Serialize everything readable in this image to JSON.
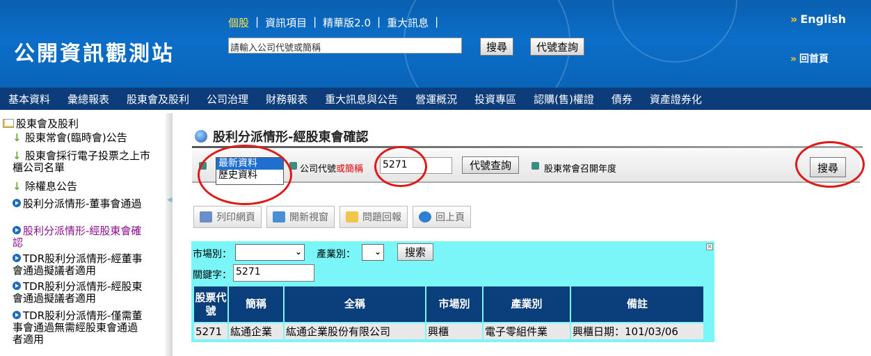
{
  "header": {
    "logo": "公開資訊觀測站",
    "topnav": [
      "個股",
      "資訊項目",
      "精華版2.0",
      "重大訊息"
    ],
    "search_placeholder": "請輸入公司代號或簡稱",
    "search_button": "搜尋",
    "code_lookup_button": "代號查詢",
    "english": "English",
    "home": "回首頁"
  },
  "mainnav": [
    "基本資料",
    "彙總報表",
    "股東會及股利",
    "公司治理",
    "財務報表",
    "重大訊息與公告",
    "營運概況",
    "投資專區",
    "認購(售)權證",
    "債券",
    "資產證券化"
  ],
  "sidebar": {
    "root": "股東會及股利",
    "items": [
      {
        "label": "股東常會(臨時會)公告",
        "icon": "download-icon"
      },
      {
        "label": "股東會採行電子投票之上市櫃公司名單",
        "icon": "download-icon"
      },
      {
        "label": "除權息公告",
        "icon": "download-icon"
      },
      {
        "label": "股利分派情形-董事會通過",
        "icon": "arrow-circle-icon"
      },
      {
        "label": "股利分派情形-經股東會確認",
        "icon": "arrow-circle-icon",
        "current": true
      },
      {
        "label": "TDR股利分派情形-經董事會通過擬議者適用",
        "icon": "arrow-circle-icon"
      },
      {
        "label": "TDR股利分派情形-經股東會通過擬議者適用",
        "icon": "arrow-circle-icon"
      },
      {
        "label": "TDR股利分派情形-僅需董事會通過無需經股東會通過者適用",
        "icon": "arrow-circle-icon"
      }
    ]
  },
  "page": {
    "title": "股利分派情形-經股東會確認",
    "options": [
      "最新資料",
      "歷史資料"
    ],
    "selected_option": "最新資料",
    "company_label_a": "公司代號",
    "company_label_b": "或簡稱",
    "company_value": "5271",
    "code_lookup": "代號查詢",
    "year_label": "股東常會召開年度",
    "search": "搜尋"
  },
  "toolbar": [
    "列印網頁",
    "開新視窗",
    "問題回報",
    "回上頁"
  ],
  "result": {
    "market_label": "市場別：",
    "industry_label": "產業別：",
    "search": "搜索",
    "keyword_label": "關鍵字：",
    "keyword_value": "5271",
    "headers": [
      "股票代號",
      "簡稱",
      "全稱",
      "市場別",
      "產業別",
      "備註"
    ],
    "rows": [
      [
        "5271",
        "紘通企業",
        "紘通企業股份有限公司",
        "興櫃",
        "電子零組件業",
        "興櫃日期：101/03/06"
      ]
    ]
  },
  "colors": {
    "header_blue": "#0b6ec8",
    "nav_dark": "#0d3c7a",
    "table_header": "#0b3f7c",
    "result_bg": "#7af6f8",
    "annotation_red": "#e01818"
  }
}
